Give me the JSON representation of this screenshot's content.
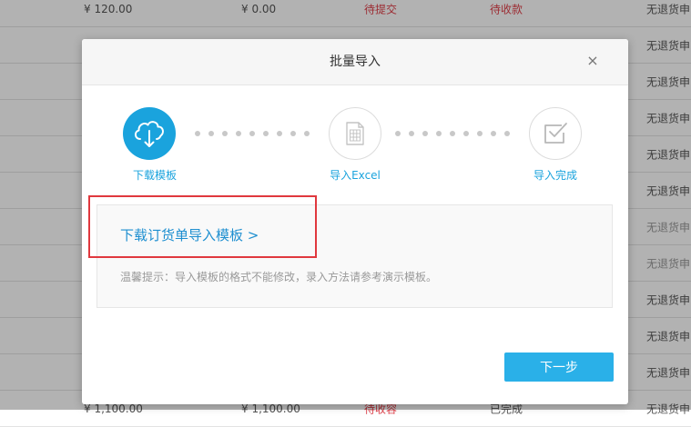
{
  "background_table": {
    "rows": [
      {
        "c1": "¥ 120.00",
        "c2": "¥ 0.00",
        "c3": "待提交",
        "c4": "待收款",
        "c5": "无退货申"
      },
      {
        "c1": "",
        "c2": "",
        "c3": "",
        "c4": "",
        "c5": "无退货申"
      },
      {
        "c1": "",
        "c2": "",
        "c3": "",
        "c4": "",
        "c5": "无退货申"
      },
      {
        "c1": "",
        "c2": "",
        "c3": "",
        "c4": "",
        "c5": "无退货申"
      },
      {
        "c1": "",
        "c2": "",
        "c3": "",
        "c4": "",
        "c5": "无退货申"
      },
      {
        "c1": "",
        "c2": "",
        "c3": "",
        "c4": "",
        "c5": "无退货申"
      },
      {
        "c1": "",
        "c2": "",
        "c3": "",
        "c4": "",
        "c5": "无退货申"
      },
      {
        "c1": "",
        "c2": "",
        "c3": "",
        "c4": "",
        "c5": "无退货申"
      },
      {
        "c1": "",
        "c2": "",
        "c3": "",
        "c4": "",
        "c5": "无退货申"
      },
      {
        "c1": "",
        "c2": "",
        "c3": "",
        "c4": "",
        "c5": "无退货申"
      },
      {
        "c1": "",
        "c2": "",
        "c3": "",
        "c4": "",
        "c5": "无退货申"
      },
      {
        "c1": "¥ 1,100.00",
        "c2": "¥ 1,100.00",
        "c3": "待收容",
        "c4": "已完成",
        "c5": "无退货申"
      }
    ]
  },
  "modal": {
    "title": "批量导入",
    "close_symbol": "×",
    "steps": [
      {
        "label": "下载模板",
        "icon": "cloud-download-icon",
        "active": true
      },
      {
        "label": "导入Excel",
        "icon": "spreadsheet-file-icon",
        "active": false
      },
      {
        "label": "导入完成",
        "icon": "checkbox-icon",
        "active": false
      }
    ],
    "download_link": "下载订货单导入模板 >",
    "tip": "温馨提示：导入模板的格式不能修改，录入方法请参考演示模板。",
    "next_button": "下一步"
  },
  "colors": {
    "accent": "#1aa3dd",
    "button": "#2ab0e8",
    "highlight": "#e0383e",
    "status_red": "#e0404a"
  }
}
